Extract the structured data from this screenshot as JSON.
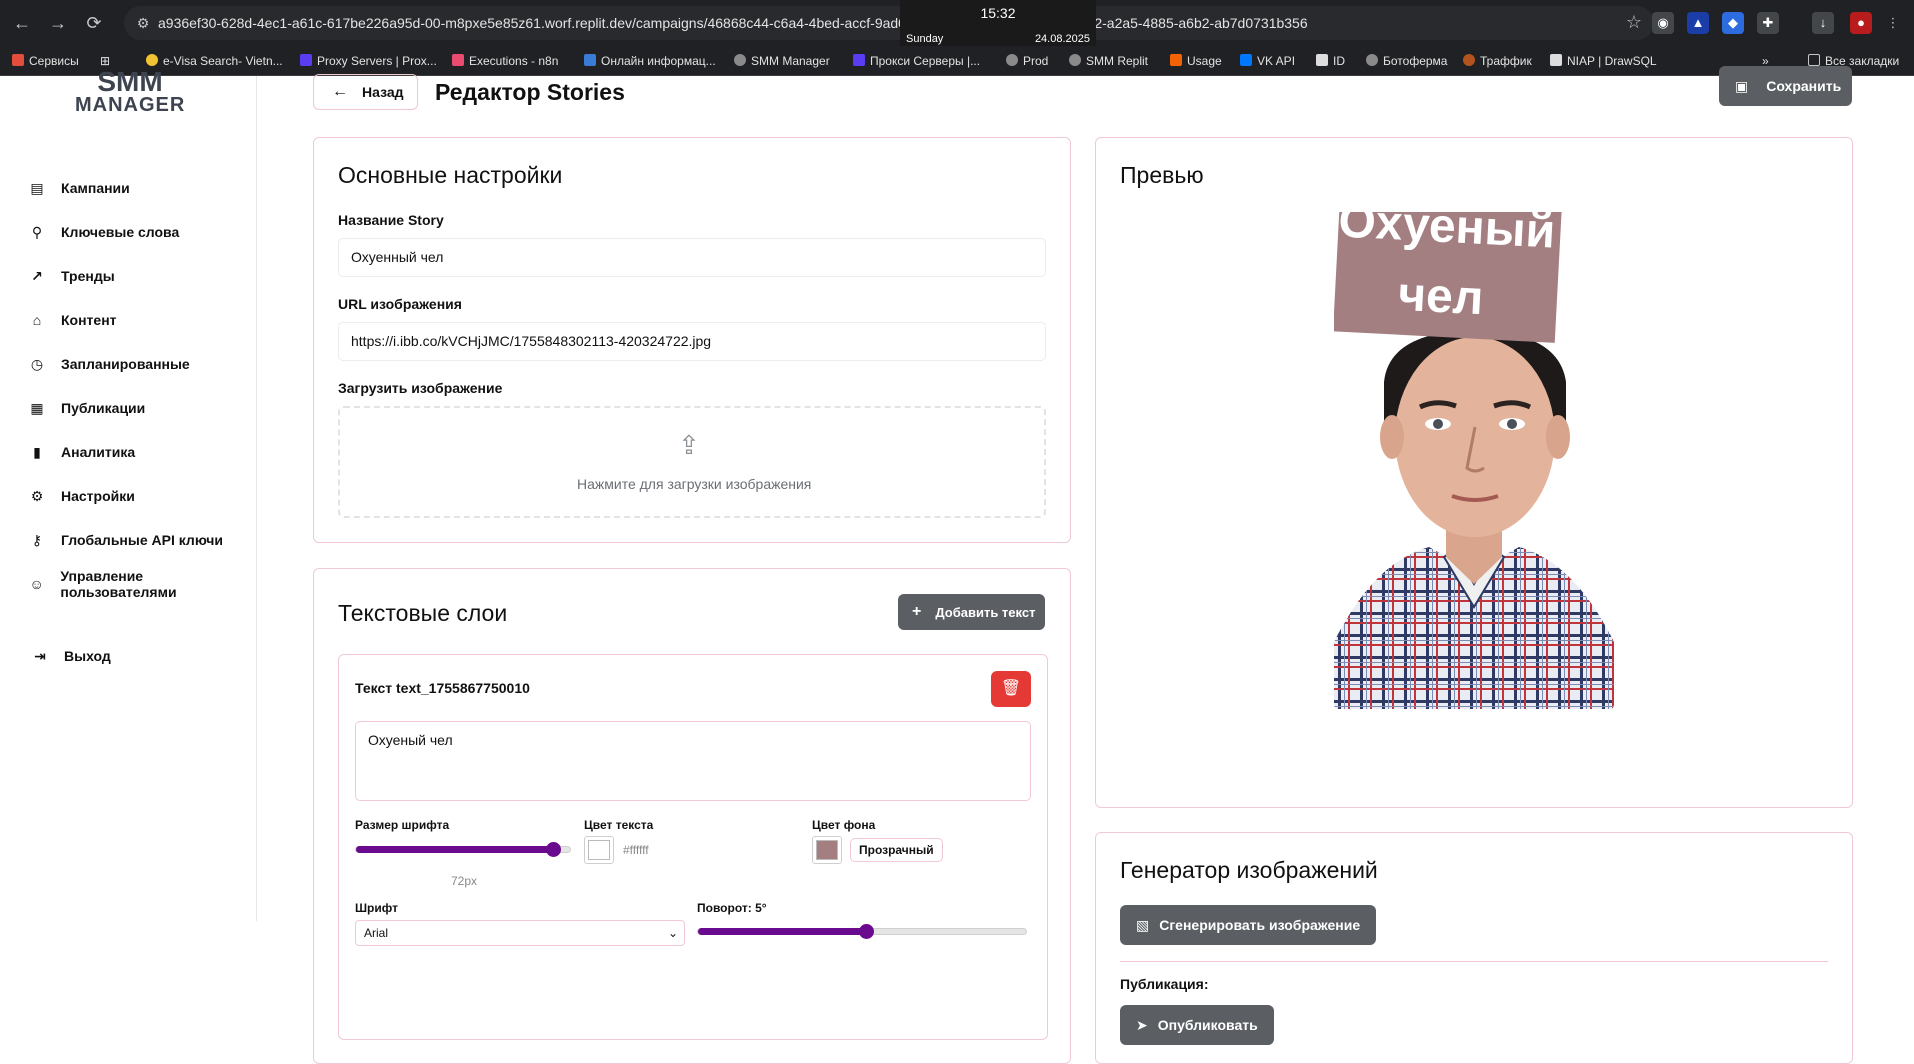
{
  "browser": {
    "url": "a936ef30-628d-4ec1-a61c-617be226a95d-00-m8pxe5e85z61.worf.replit.dev/campaigns/46868c44-c6a4-4bed-accf-9ad07bba790e/stories/edit/9f4a6902-a2a5-4885-a6b2-ab7d0731b356",
    "clock": {
      "time": "15:32",
      "day": "Sunday",
      "date": "24.08.2025"
    },
    "bookmarks": [
      "Сервисы",
      "e-Visa Search- Vietn...",
      "Proxy Servers | Prox...",
      "Executions - n8n",
      "Онлайн информац...",
      "SMM Manager",
      "Прокси Серверы |...",
      "Prod",
      "SMM Replit",
      "Usage",
      "VK API",
      "ID",
      "Ботоферма",
      "Траффик",
      "NIAP | DrawSQL"
    ],
    "all_bookmarks": "Все закладки"
  },
  "logo": {
    "line1": "SMM",
    "line2": "MANAGER"
  },
  "sidebar": {
    "items": [
      {
        "label": "Кампании",
        "icon": "document-icon"
      },
      {
        "label": "Ключевые слова",
        "icon": "search-icon"
      },
      {
        "label": "Тренды",
        "icon": "trend-icon"
      },
      {
        "label": "Контент",
        "icon": "tag-icon"
      },
      {
        "label": "Запланированные",
        "icon": "clock-icon"
      },
      {
        "label": "Публикации",
        "icon": "calendar-icon"
      },
      {
        "label": "Аналитика",
        "icon": "chart-icon"
      },
      {
        "label": "Настройки",
        "icon": "gear-icon"
      },
      {
        "label": "Глобальные API ключи",
        "icon": "key-icon"
      },
      {
        "label": "Управление пользователями",
        "icon": "users-icon"
      }
    ],
    "logout": "Выход"
  },
  "header": {
    "back": "Назад",
    "title": "Редактор Stories",
    "save": "Сохранить"
  },
  "basic": {
    "title": "Основные настройки",
    "name_label": "Название Story",
    "name_value": "Охуенный чел",
    "url_label": "URL изображения",
    "url_value": "https://i.ibb.co/kVCHjJMC/1755848302113-420324722.jpg",
    "upload_label": "Загрузить изображение",
    "upload_hint": "Нажмите для загрузки изображения"
  },
  "layers": {
    "title": "Текстовые слои",
    "add_button": "Добавить текст",
    "layer": {
      "title": "Текст text_1755867750010",
      "text": "Охуеный чел",
      "font_size_label": "Размер шрифта",
      "font_size_value": "72px",
      "font_size_fraction": 0.91,
      "text_color_label": "Цвет текста",
      "text_color": "#ffffff",
      "bg_color_label": "Цвет фона",
      "bg_color": "#a47f82",
      "transparent_label": "Прозрачный",
      "font_label": "Шрифт",
      "font_value": "Arial",
      "rotation_label": "Поворот: 5°",
      "rotation_fraction": 0.51
    }
  },
  "preview": {
    "title": "Превью",
    "overlay_line1": "Охуеный",
    "overlay_line2": "чел"
  },
  "generator": {
    "title": "Генератор изображений",
    "generate_button": "Сгенерировать изображение",
    "publish_label": "Публикация:",
    "publish_button": "Опубликовать"
  },
  "colors": {
    "accent": "#6a0a8e",
    "button": "#5b5f63",
    "danger": "#e53935",
    "border": "#f2c9d2"
  }
}
